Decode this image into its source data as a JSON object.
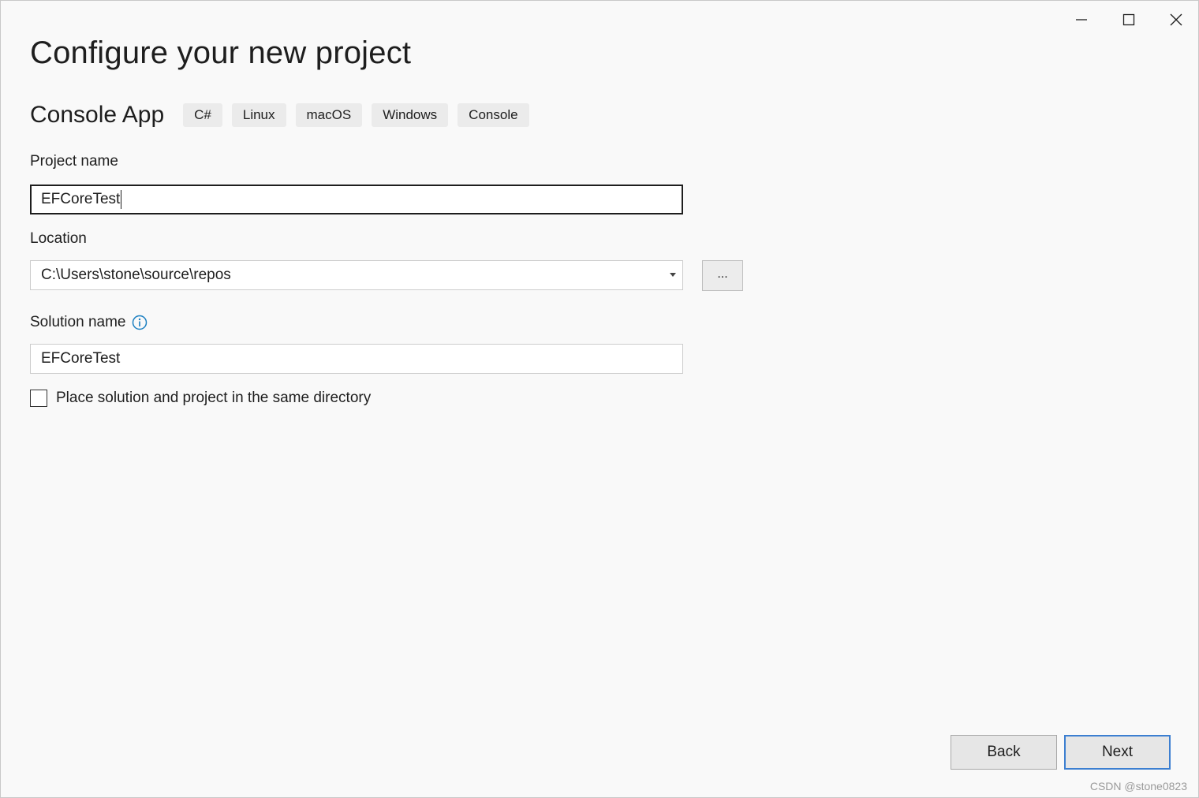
{
  "window": {
    "controls": {
      "minimize_icon": "minimize-icon",
      "maximize_icon": "maximize-icon",
      "close_icon": "close-icon"
    }
  },
  "page": {
    "title": "Configure your new project"
  },
  "template": {
    "name": "Console App",
    "tags": [
      "C#",
      "Linux",
      "macOS",
      "Windows",
      "Console"
    ]
  },
  "form": {
    "project_name": {
      "label": "Project name",
      "value": "EFCoreTest"
    },
    "location": {
      "label": "Location",
      "value": "C:\\Users\\stone\\source\\repos",
      "browse_label": "..."
    },
    "solution_name": {
      "label": "Solution name",
      "value": "EFCoreTest",
      "info_icon": "info-icon"
    },
    "same_directory": {
      "label": "Place solution and project in the same directory",
      "checked": false
    }
  },
  "buttons": {
    "back": "Back",
    "next": "Next"
  },
  "watermark": "CSDN @stone0823",
  "colors": {
    "background": "#f9f9f9",
    "accent_border": "#3c7fd1",
    "info_icon": "#1a7fc1",
    "tag_background": "#ebebeb"
  }
}
